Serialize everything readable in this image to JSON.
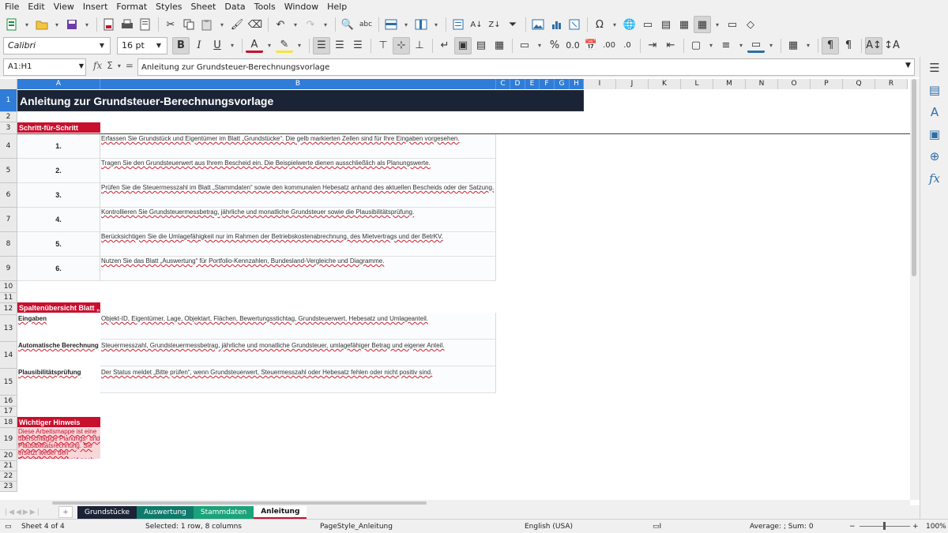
{
  "menu": [
    "File",
    "Edit",
    "View",
    "Insert",
    "Format",
    "Styles",
    "Sheet",
    "Data",
    "Tools",
    "Window",
    "Help"
  ],
  "font": {
    "name": "Calibri",
    "size": "16 pt"
  },
  "namebox": "A1:H1",
  "formula": "Anleitung zur Grundsteuer-Berechnungsvorlage",
  "columns": [
    "A",
    "B",
    "C",
    "D",
    "E",
    "F",
    "G",
    "H",
    "I",
    "J",
    "K",
    "L",
    "M",
    "N",
    "O",
    "P",
    "Q",
    "R"
  ],
  "rows": [
    "1",
    "2",
    "3",
    "4",
    "5",
    "6",
    "7",
    "8",
    "9",
    "10",
    "11",
    "12",
    "13",
    "14",
    "15",
    "16",
    "17",
    "18",
    "19",
    "20",
    "21",
    "22",
    "23"
  ],
  "sheet": {
    "title": "Anleitung zur Grundsteuer-Berechnungsvorlage",
    "steps_header": "Schritt-für-Schritt",
    "steps": [
      {
        "num": "1.",
        "text": "Erfassen Sie Grundstück und Eigentümer im Blatt „Grundstücke“. Die gelb markierten Zellen sind für Ihre Eingaben vorgesehen."
      },
      {
        "num": "2.",
        "text": "Tragen Sie den Grundsteuerwert aus Ihrem Bescheid ein. Die Beispielwerte dienen ausschließlich als Planungswerte."
      },
      {
        "num": "3.",
        "text": "Prüfen Sie die Steuermesszahl im Blatt „Stammdaten“ sowie den kommunalen Hebesatz anhand des aktuellen Bescheids oder der Satzung."
      },
      {
        "num": "4.",
        "text": "Kontrollieren Sie Grundsteuermessbetrag, jährliche und monatliche Grundsteuer sowie die Plausibilitätsprüfung."
      },
      {
        "num": "5.",
        "text": "Berücksichtigen Sie die Umlagefähigkeit nur im Rahmen der Betriebskostenabrechnung, des Mietvertrags und der BetrKV."
      },
      {
        "num": "6.",
        "text": "Nutzen Sie das Blatt „Auswertung“ für Portfolio-Kennzahlen, Bundesland-Vergleiche und Diagramme."
      }
    ],
    "columns_header": "Spaltenübersicht Blatt „G",
    "columns_overview": [
      {
        "label": "Eingaben",
        "text": "Objekt-ID, Eigentümer, Lage, Objektart, Flächen, Bewertungsstichtag, Grundsteuerwert, Hebesatz und Umlageanteil."
      },
      {
        "label": "Automatische Berechnung",
        "text": "Steuermesszahl, Grundsteuermessbetrag, jährliche und monatliche Grundsteuer, umlagefähiger Betrag und eigener Anteil."
      },
      {
        "label": "Plausibilitätsprüfung",
        "text": "Der Status meldet „Bitte prüfen“, wenn Grundsteuerwert, Steuermesszahl oder Hebesatz fehlen oder nicht positiv sind."
      }
    ],
    "notice_header": "Wichtiger Hinweis",
    "notice_text": "Diese Arbeitsmappe ist eine überschlägige Planungs- und Plausibilitätsrechnung. Sie ersetzt weder den Grundsteuerbescheid noch"
  },
  "tabs": [
    {
      "label": "Grundstücke",
      "color": "#1b2336"
    },
    {
      "label": "Auswertung",
      "color": "#0f7a6b"
    },
    {
      "label": "Stammdaten",
      "color": "#1aa37a"
    },
    {
      "label": "Anleitung",
      "color": "#ffffff"
    }
  ],
  "status": {
    "sheet": "Sheet 4 of 4",
    "selection": "Selected: 1 row, 8 columns",
    "pagestyle": "PageStyle_Anleitung",
    "language": "English (USA)",
    "sum": "Average: ; Sum: 0",
    "zoom": "100%"
  },
  "colors": {
    "title_bg": "#1b2336",
    "section_red": "#c8102e",
    "selection_blue": "#2f7dd8"
  }
}
